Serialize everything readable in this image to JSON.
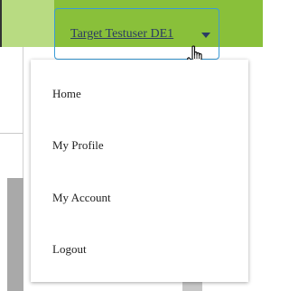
{
  "header": {
    "user_name": "Target Testuser DE1",
    "caret_icon": "caret-down-icon",
    "cursor_icon": "hand-pointer-icon"
  },
  "menu": {
    "items": [
      {
        "label": "Home"
      },
      {
        "label": "My Profile"
      },
      {
        "label": "My Account"
      },
      {
        "label": "Logout"
      }
    ]
  },
  "colors": {
    "topbar": "#89c03a",
    "topbar_left": "#b8db82",
    "focus_border": "#3a9bd8",
    "user_text": "#2b3c63"
  }
}
